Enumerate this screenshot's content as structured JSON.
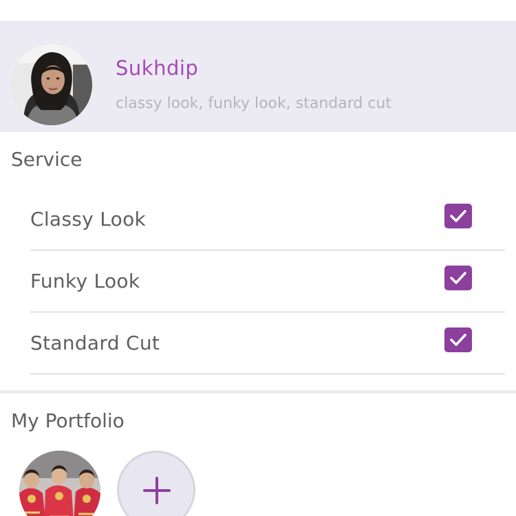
{
  "profile": {
    "name": "Sukhdip",
    "tags": "classy look, funky look, standard cut",
    "avatar_icon": "profile-photo"
  },
  "service": {
    "title": "Service",
    "items": [
      {
        "label": "Classy Look",
        "checked": true
      },
      {
        "label": "Funky Look",
        "checked": true
      },
      {
        "label": "Standard Cut",
        "checked": true
      }
    ]
  },
  "portfolio": {
    "title": "My Portfolio",
    "add_icon": "plus-icon"
  },
  "colors": {
    "accent": "#8d3f9d",
    "name": "#a44bb6",
    "header_bg": "#ecebf3",
    "tags": "#b6b3bd",
    "text": "#5f5f5f"
  }
}
